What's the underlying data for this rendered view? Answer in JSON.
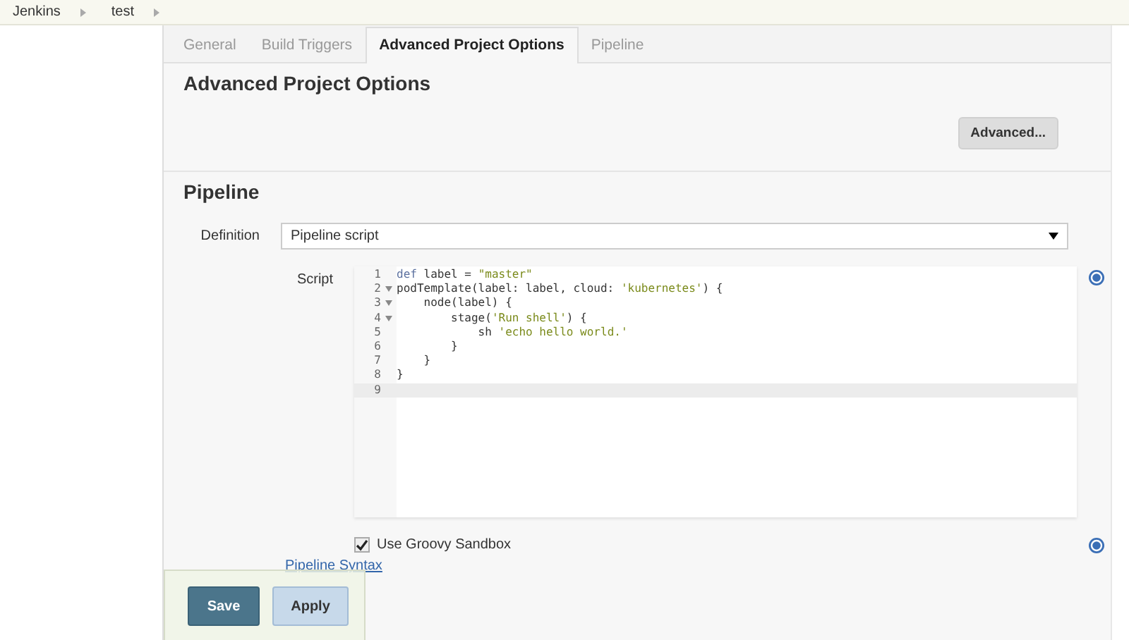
{
  "breadcrumbs": [
    "Jenkins",
    "test"
  ],
  "tabs": [
    {
      "label": "General",
      "selected": false
    },
    {
      "label": "Build Triggers",
      "selected": false
    },
    {
      "label": "Advanced Project Options",
      "selected": true
    },
    {
      "label": "Pipeline",
      "selected": false
    }
  ],
  "advanced_section": {
    "title": "Advanced Project Options",
    "button": "Advanced..."
  },
  "pipeline_section": {
    "title": "Pipeline",
    "definition": {
      "label": "Definition",
      "value": "Pipeline script"
    },
    "script": {
      "label": "Script",
      "lines": [
        {
          "number": "1",
          "foldable": false,
          "active": false,
          "tokens": [
            {
              "kind": "keyword",
              "text": "def"
            },
            {
              "kind": "plain",
              "text": " label = "
            },
            {
              "kind": "string",
              "text": "\"master\""
            }
          ]
        },
        {
          "number": "2",
          "foldable": true,
          "active": false,
          "tokens": [
            {
              "kind": "plain",
              "text": "podTemplate(label: label, cloud: "
            },
            {
              "kind": "string",
              "text": "'kubernetes'"
            },
            {
              "kind": "plain",
              "text": ") {"
            }
          ]
        },
        {
          "number": "3",
          "foldable": true,
          "active": false,
          "tokens": [
            {
              "kind": "plain",
              "text": "    node(label) {"
            }
          ]
        },
        {
          "number": "4",
          "foldable": true,
          "active": false,
          "tokens": [
            {
              "kind": "plain",
              "text": "        stage("
            },
            {
              "kind": "string",
              "text": "'Run shell'"
            },
            {
              "kind": "plain",
              "text": ") {"
            }
          ]
        },
        {
          "number": "5",
          "foldable": false,
          "active": false,
          "tokens": [
            {
              "kind": "plain",
              "text": "            sh "
            },
            {
              "kind": "string",
              "text": "'echo hello world.'"
            }
          ]
        },
        {
          "number": "6",
          "foldable": false,
          "active": false,
          "tokens": [
            {
              "kind": "plain",
              "text": "        }"
            }
          ]
        },
        {
          "number": "7",
          "foldable": false,
          "active": false,
          "tokens": [
            {
              "kind": "plain",
              "text": "    }"
            }
          ]
        },
        {
          "number": "8",
          "foldable": false,
          "active": false,
          "tokens": [
            {
              "kind": "plain",
              "text": "}"
            }
          ]
        },
        {
          "number": "9",
          "foldable": false,
          "active": true
        }
      ]
    },
    "sandbox": {
      "label": "Use Groovy Sandbox",
      "checked": true
    },
    "syntax_link": "Pipeline Syntax"
  },
  "buttons": [
    {
      "label": "Save",
      "kind": "primary"
    },
    {
      "label": "Apply",
      "kind": "secondary"
    }
  ]
}
